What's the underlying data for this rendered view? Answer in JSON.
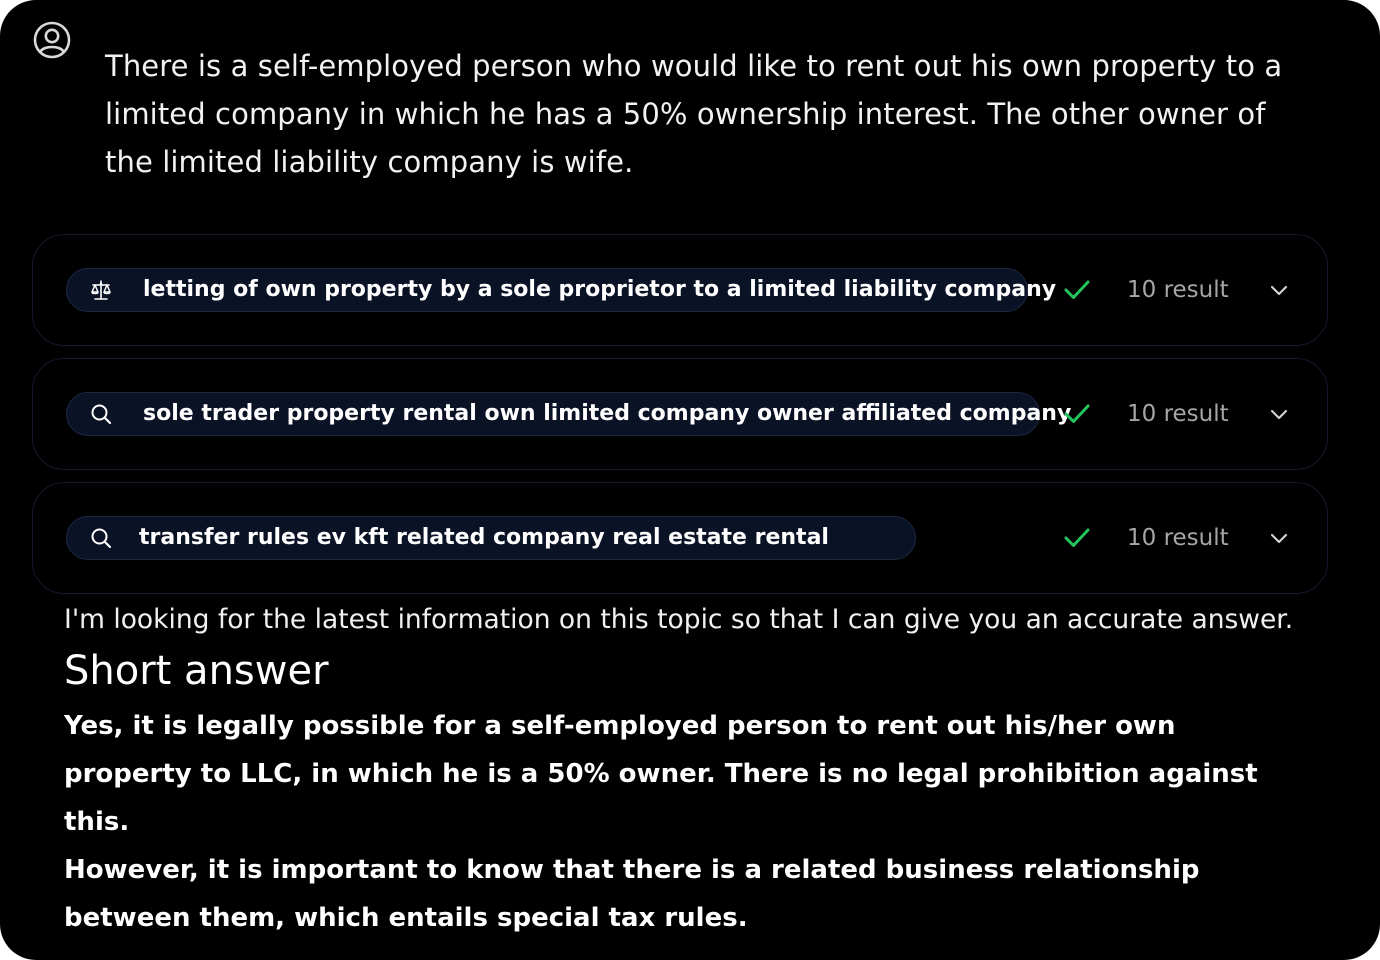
{
  "user": {
    "avatar_icon": "user-circle-icon",
    "message": "There is a self-employed person who would like to rent out his own property to a limited company in which he has a 50% ownership interest. The other owner of the limited liability company is wife."
  },
  "searches": [
    {
      "icon": "scales-icon",
      "query": "letting of own property by a sole proprietor to a limited liability company",
      "status_icon": "check-icon",
      "result_count": "10 result"
    },
    {
      "icon": "search-icon",
      "query": "sole trader property rental own limited company owner affiliated company",
      "status_icon": "check-icon",
      "result_count": "10 result"
    },
    {
      "icon": "search-icon",
      "query": "transfer rules ev kft related company real estate rental",
      "status_icon": "check-icon",
      "result_count": "10 result"
    }
  ],
  "answer": {
    "intro": "I'm looking for the latest information on this topic so that I can give you an accurate answer.",
    "heading": "Short answer",
    "paragraph_1": "Yes, it is legally possible for a self-employed person to rent out his/her own property to LLC, in which he is a 50% owner. There is no legal prohibition against this.",
    "paragraph_2": "However, it is important to know that there is a related business relationship between them, which entails special tax rules."
  },
  "colors": {
    "background": "#000000",
    "pill_background": "#0a1226",
    "check_green": "#22c55e",
    "muted_text": "#a6a6a6"
  }
}
